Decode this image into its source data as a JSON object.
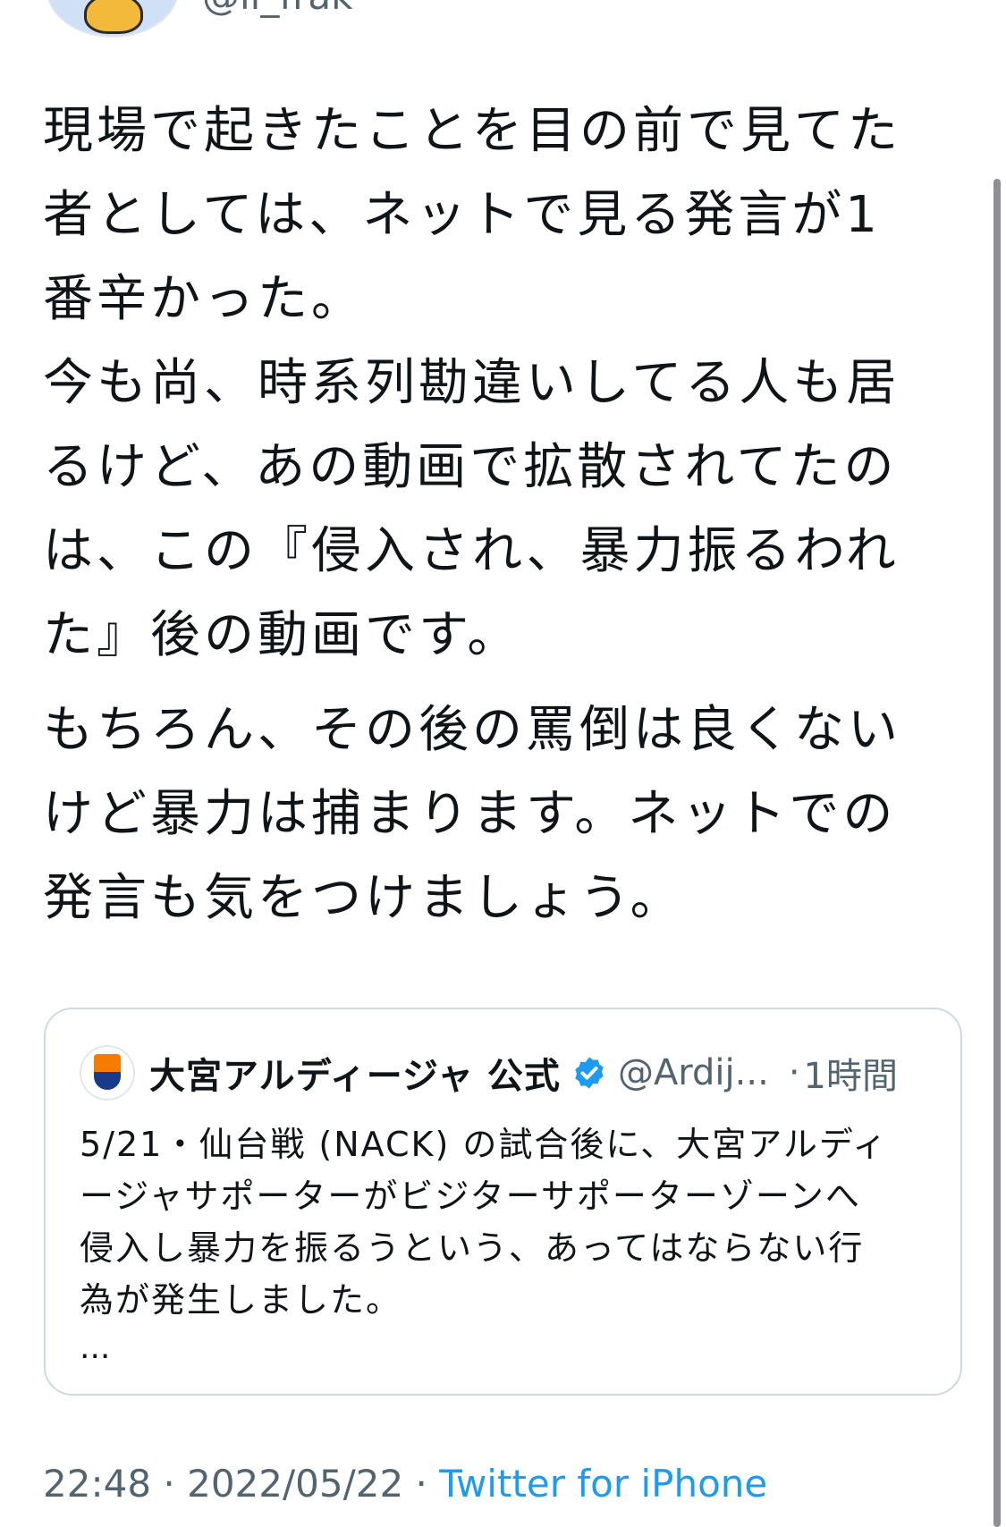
{
  "author": {
    "handle": "@li_frak"
  },
  "tweet": {
    "paragraphs": [
      "現場で起きたことを目の前で見てた\n者としては、ネットで見る発言が1\n番辛かった。\n今も尚、時系列勘違いしてる人も居\nるけど、あの動画で拡散されてたの\nは、この『侵入され、暴力振るわれ\nた』後の動画です。",
      "もちろん、その後の罵倒は良くない\nけど暴力は捕まります。ネットでの\n発言も気をつけましょう。"
    ]
  },
  "quoted_tweet": {
    "name": "大宮アルディージャ 公式",
    "handle": "@Ardij...",
    "separator": "·",
    "time": "1時間",
    "text": "5/21・仙台戦 (NACK) の試合後に、大宮アルディ\nージャサポーターがビジターサポーターゾーンへ\n侵入し暴力を振るうという、あってはならない行\n為が発生しました。",
    "more": "..."
  },
  "meta": {
    "time": "22:48",
    "sep1": " · ",
    "date": "2022/05/22",
    "sep2": " · ",
    "source": "Twitter for iPhone"
  },
  "colors": {
    "verified": "#1d9bf0",
    "link": "#1d9bf0",
    "secondary_text": "#536471"
  }
}
